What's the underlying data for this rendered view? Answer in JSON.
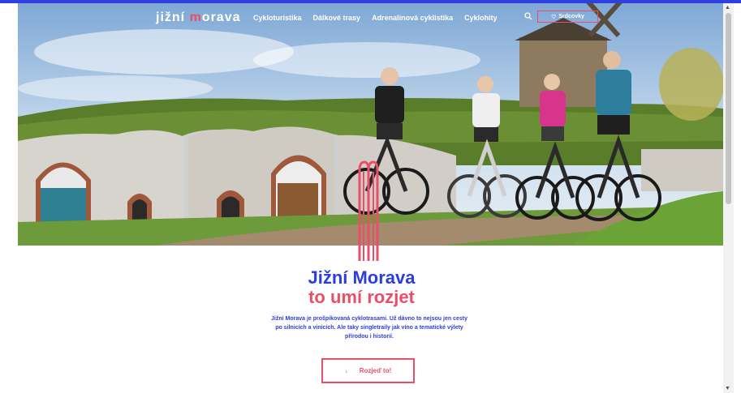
{
  "brand": {
    "logo_prefix": "jižní ",
    "logo_m": "m",
    "logo_suffix": "orava"
  },
  "nav": {
    "items": [
      "Cykloturistika",
      "Dálkové trasy",
      "Adrenalinová cyklistika",
      "Cyklohity"
    ],
    "favorites_label": "Srdcovky",
    "icons": {
      "search": "search-icon",
      "favorites": "heart-icon"
    }
  },
  "hero": {
    "image_alt": ""
  },
  "content": {
    "title_line1": "Jižní Morava",
    "title_line2": "to umí rozjet",
    "description": "Jižní Morava je prošpikovaná cyklotrasami. Už dávno to nejsou jen cesty po silnicích a vinicích. Ale taky singletraily jak víno a tematické výlety přírodou i historií.",
    "cta_label": "Rozjeď to!",
    "cta_icon": "arrow-down-icon"
  },
  "colors": {
    "accent_blue": "#2a3fd8",
    "accent_pink": "#e8506a",
    "topbar": "#2f3fe0"
  }
}
